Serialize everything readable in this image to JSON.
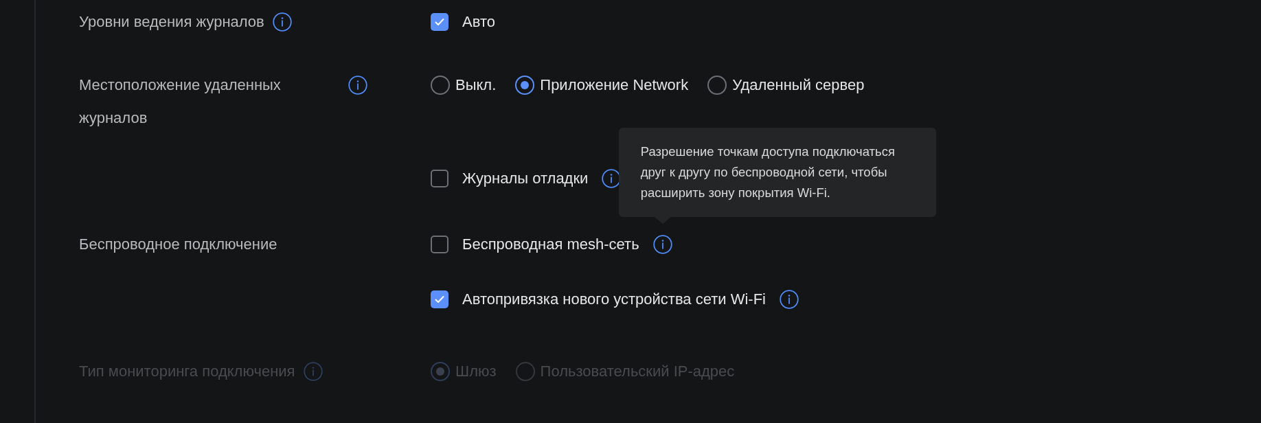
{
  "settings": [
    {
      "label": "Уровни ведения журналов",
      "info": true,
      "disabled": false,
      "options": [
        {
          "kind": "checkbox",
          "label": "Авто",
          "checked": true,
          "info": false
        }
      ]
    },
    {
      "label": "Местоположение удаленных журналов",
      "info": true,
      "disabled": false,
      "options": [
        {
          "kind": "radio-group",
          "choices": [
            {
              "label": "Выкл.",
              "selected": false
            },
            {
              "label": "Приложение Network",
              "selected": true
            },
            {
              "label": "Удаленный сервер",
              "selected": false
            }
          ]
        },
        {
          "kind": "checkbox",
          "label": "Журналы отладки",
          "checked": false,
          "info": true
        }
      ]
    },
    {
      "label": "Беспроводное подключение",
      "info": false,
      "disabled": false,
      "options": [
        {
          "kind": "checkbox",
          "label": "Беспроводная mesh-сеть",
          "checked": false,
          "info": true,
          "tooltip": "Разрешение точкам доступа подключаться друг к другу по беспроводной сети, чтобы расширить зону покрытия Wi-Fi."
        },
        {
          "kind": "checkbox",
          "label": "Автопривязка нового устройства сети Wi-Fi",
          "checked": true,
          "info": true
        }
      ]
    },
    {
      "label": "Тип мониторинга подключения",
      "info": true,
      "disabled": true,
      "options": [
        {
          "kind": "radio-group",
          "choices": [
            {
              "label": "Шлюз",
              "selected": true
            },
            {
              "label": "Пользовательский IP-адрес",
              "selected": false
            }
          ]
        }
      ]
    }
  ]
}
